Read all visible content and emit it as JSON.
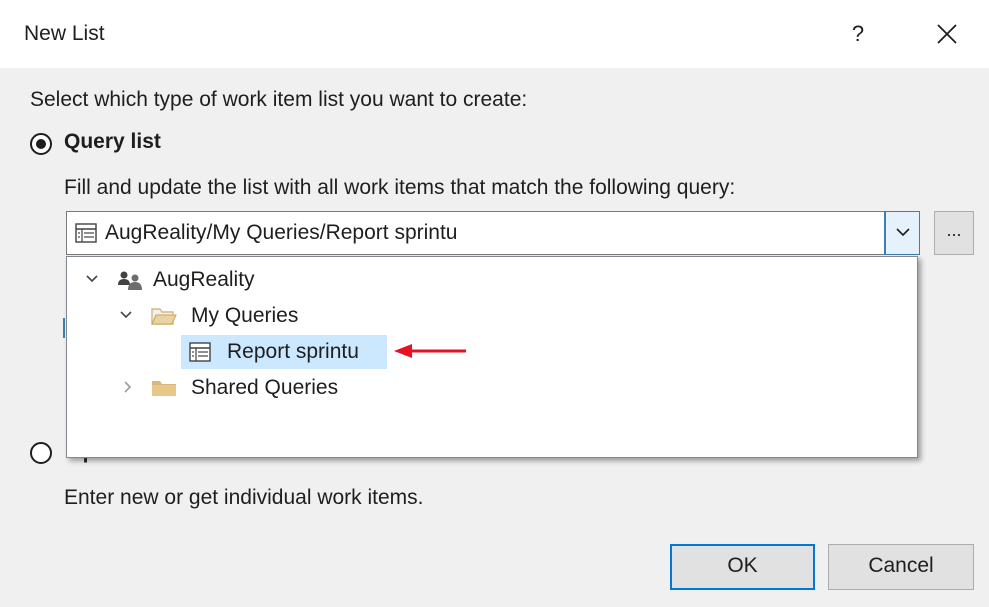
{
  "window": {
    "title": "New List",
    "help_label": "?"
  },
  "intro": "Select which type of work item list you want to create:",
  "query_option": {
    "label": "Query list",
    "selected": true,
    "description": "Fill and update the list with all work items that match the following query:",
    "combo_value": "AugReality/My Queries/Report sprintu",
    "browse_label": "..."
  },
  "tree": {
    "root": {
      "label": "AugReality",
      "icon": "team-icon",
      "expanded": true
    },
    "my_queries": {
      "label": "My Queries",
      "icon": "folder-open-icon",
      "expanded": true
    },
    "report": {
      "label": "Report sprintu",
      "icon": "query-icon",
      "selected": true
    },
    "shared_queries": {
      "label": "Shared Queries",
      "icon": "folder-icon",
      "expanded": false
    }
  },
  "input_option": {
    "label": "Input list",
    "selected": false,
    "description": "Enter new or get individual work items."
  },
  "buttons": {
    "ok": "OK",
    "cancel": "Cancel"
  },
  "colors": {
    "accent": "#0078d7",
    "selection": "#cce8ff",
    "annotation_arrow": "#e81123",
    "folder": "#dcb67a"
  }
}
